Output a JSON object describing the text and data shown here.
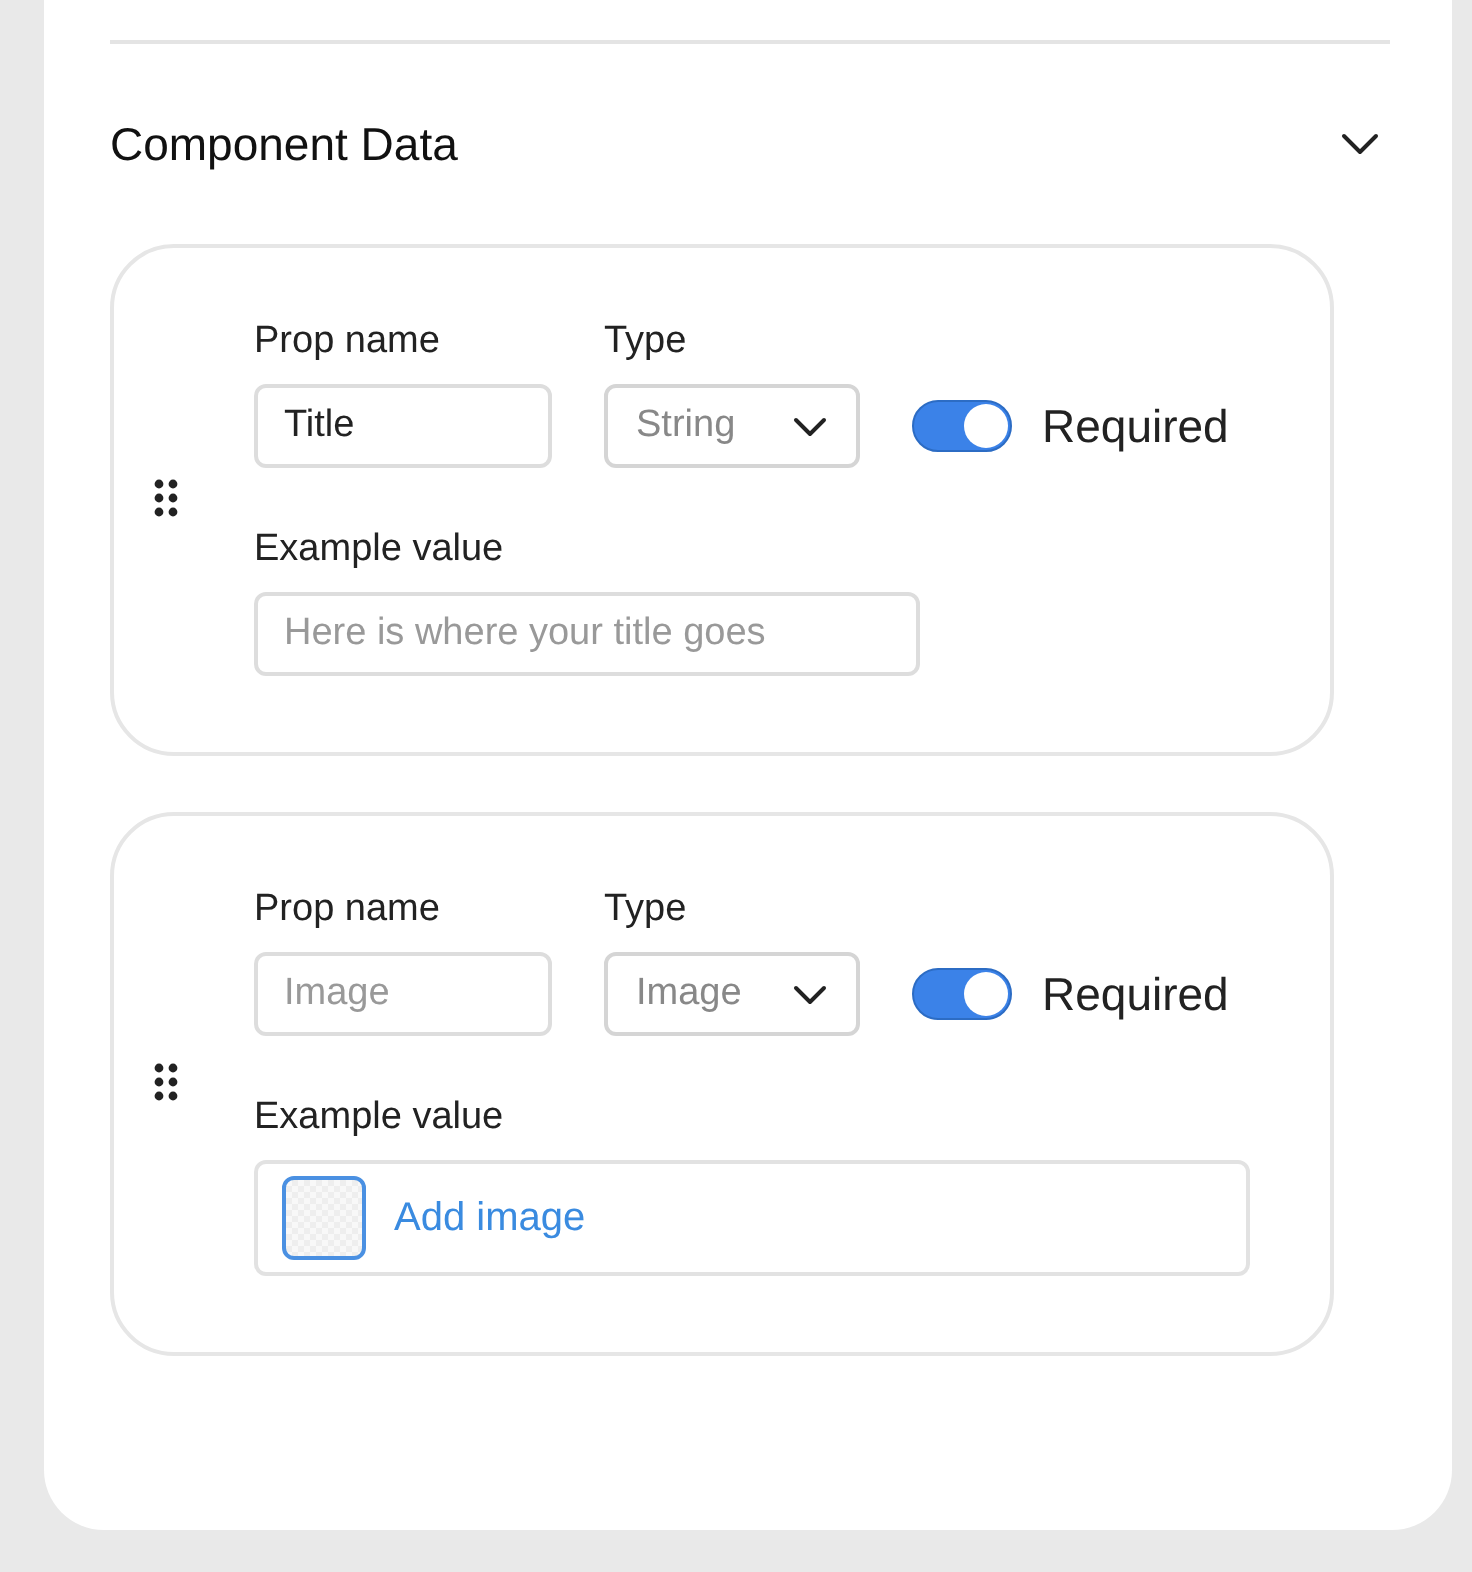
{
  "section": {
    "title": "Component Data",
    "expanded": true
  },
  "props": [
    {
      "name_label": "Prop name",
      "name_value": "Title",
      "type_label": "Type",
      "type_value": "String",
      "required": true,
      "required_label": "Required",
      "example_label": "Example value",
      "example": {
        "kind": "text",
        "placeholder": "Here is where your title goes"
      }
    },
    {
      "name_label": "Prop name",
      "name_placeholder": "Image",
      "type_label": "Type",
      "type_value": "Image",
      "required": true,
      "required_label": "Required",
      "example_label": "Example value",
      "example": {
        "kind": "image",
        "action": "Add image"
      }
    }
  ]
}
